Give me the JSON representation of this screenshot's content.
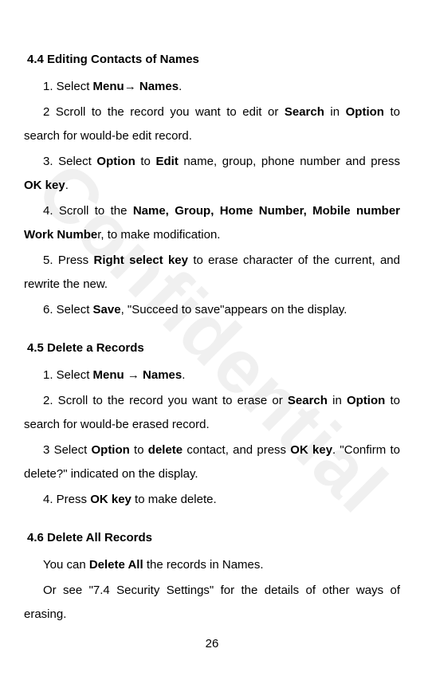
{
  "watermark": "Confidential",
  "pageNumber": "26",
  "sections": [
    {
      "heading": "4.4 Editing Contacts of Names",
      "items": [
        {
          "type": "para",
          "segments": [
            {
              "text": "1. Select ",
              "bold": false
            },
            {
              "text": "Menu→ Names",
              "bold": true
            },
            {
              "text": ".",
              "bold": false
            }
          ]
        },
        {
          "type": "para",
          "segments": [
            {
              "text": "2 Scroll to the record you want to edit or ",
              "bold": false
            },
            {
              "text": "Search",
              "bold": true
            },
            {
              "text": " in ",
              "bold": false
            },
            {
              "text": "Option",
              "bold": true
            },
            {
              "text": " to search for would-be edit record.",
              "bold": false
            }
          ]
        },
        {
          "type": "para",
          "segments": [
            {
              "text": "3. Select ",
              "bold": false
            },
            {
              "text": "Option",
              "bold": true
            },
            {
              "text": " to ",
              "bold": false
            },
            {
              "text": "Edit",
              "bold": true
            },
            {
              "text": " name, group, phone number and press ",
              "bold": false
            },
            {
              "text": "OK key",
              "bold": true
            },
            {
              "text": ".",
              "bold": false
            }
          ]
        },
        {
          "type": "para",
          "segments": [
            {
              "text": "4. Scroll to the ",
              "bold": false
            },
            {
              "text": "Name, Group, Home Number, Mobile number Work Numbe",
              "bold": true
            },
            {
              "text": "r, to make modification.",
              "bold": false
            }
          ]
        },
        {
          "type": "para",
          "segments": [
            {
              "text": "5. Press ",
              "bold": false
            },
            {
              "text": "Right select key",
              "bold": true
            },
            {
              "text": " to erase character of the current, and rewrite the new.",
              "bold": false
            }
          ]
        },
        {
          "type": "para",
          "segments": [
            {
              "text": "6. Select ",
              "bold": false
            },
            {
              "text": "Save",
              "bold": true
            },
            {
              "text": ", \"Succeed to save\"appears on the display.",
              "bold": false
            }
          ]
        }
      ]
    },
    {
      "heading": "4.5 Delete a Records",
      "items": [
        {
          "type": "para",
          "segments": [
            {
              "text": "1. Select ",
              "bold": false
            },
            {
              "text": "Menu → Names",
              "bold": true
            },
            {
              "text": ".",
              "bold": false
            }
          ]
        },
        {
          "type": "para",
          "segments": [
            {
              "text": "2. Scroll to the record you want to erase or ",
              "bold": false
            },
            {
              "text": "Search",
              "bold": true
            },
            {
              "text": " in ",
              "bold": false
            },
            {
              "text": "Option",
              "bold": true
            },
            {
              "text": " to search for would-be erased record.",
              "bold": false
            }
          ]
        },
        {
          "type": "para",
          "segments": [
            {
              "text": "3 Select ",
              "bold": false
            },
            {
              "text": "Option",
              "bold": true
            },
            {
              "text": " to ",
              "bold": false
            },
            {
              "text": "delete",
              "bold": true
            },
            {
              "text": " contact, and press ",
              "bold": false
            },
            {
              "text": "OK key",
              "bold": true
            },
            {
              "text": ". \"Confirm to delete?\" indicated on the display.",
              "bold": false
            }
          ]
        },
        {
          "type": "para",
          "segments": [
            {
              "text": "4. Press ",
              "bold": false
            },
            {
              "text": "OK key",
              "bold": true
            },
            {
              "text": " to make delete.",
              "bold": false
            }
          ]
        }
      ]
    },
    {
      "heading": "4.6 Delete All Records",
      "items": [
        {
          "type": "para",
          "segments": [
            {
              "text": "You can ",
              "bold": false
            },
            {
              "text": "Delete All",
              "bold": true
            },
            {
              "text": " the records in Names.",
              "bold": false
            }
          ]
        },
        {
          "type": "para",
          "segments": [
            {
              "text": "Or see \"7.4 Security Settings\" for the details of other ways of erasing.",
              "bold": false
            }
          ]
        }
      ]
    }
  ]
}
